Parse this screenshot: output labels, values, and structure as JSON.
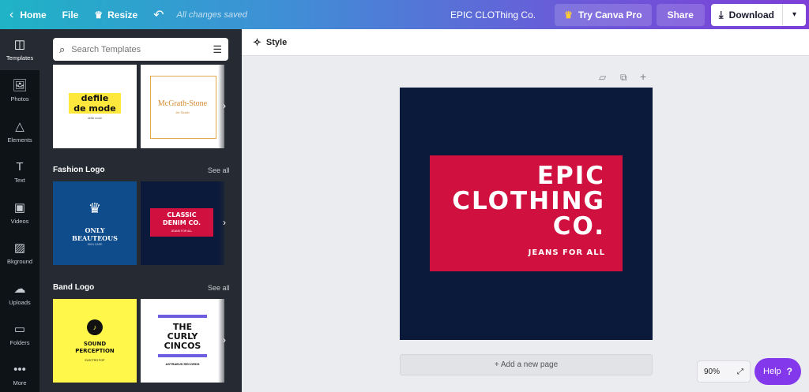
{
  "topbar": {
    "home_label": "Home",
    "file_label": "File",
    "resize_label": "Resize",
    "saved_status": "All changes saved",
    "doc_title": "EPIC CLOThing Co.",
    "try_pro_label": "Try Canva Pro",
    "share_label": "Share",
    "download_label": "Download",
    "icons": {
      "home": "chevron-left-icon",
      "resize": "crown-icon",
      "undo": "undo-icon",
      "download": "download-icon",
      "dropdown": "chevron-down-icon"
    }
  },
  "rail": {
    "items": [
      {
        "label": "Templates",
        "icon": "template-icon",
        "active": true
      },
      {
        "label": "Photos",
        "icon": "photo-icon"
      },
      {
        "label": "Elements",
        "icon": "shapes-icon"
      },
      {
        "label": "Text",
        "icon": "text-icon"
      },
      {
        "label": "Videos",
        "icon": "video-icon"
      },
      {
        "label": "Bkground",
        "icon": "background-icon"
      },
      {
        "label": "Uploads",
        "icon": "upload-icon"
      },
      {
        "label": "Folders",
        "icon": "folder-icon"
      },
      {
        "label": "More",
        "icon": "more-icon"
      }
    ]
  },
  "panel": {
    "search_placeholder": "Search Templates",
    "sections": [
      {
        "title": "Fashion Logo",
        "see_all": "See all"
      },
      {
        "title": "Band Logo",
        "see_all": "See all"
      }
    ],
    "templates": {
      "t1": {
        "name": "defile\nde mode",
        "sub": "defile mode"
      },
      "t2": {
        "name": "McGrath-Stone",
        "sub": "Art Studio"
      },
      "t3": {
        "name": "ONLY\nBEAUTEOUS",
        "sub": "SKIN CARE"
      },
      "t4": {
        "name": "CLASSIC\nDENIM CO.",
        "sub": "JEANS FOR ALL"
      },
      "t5": {
        "name": "SOUND\nPERCEPTION",
        "sub": "ELECTRO POP"
      },
      "t6": {
        "name": "THE\nCURLY\nCINCOS",
        "sub": "ASTRAEUS RECORDS"
      }
    }
  },
  "main": {
    "style_label": "Style",
    "canvas": {
      "title": "EPIC\nCLOTHING\nCO.",
      "tagline": "JEANS FOR ALL",
      "bg_color": "#0b1a3b",
      "box_color": "#d0103f"
    },
    "add_page_label": "+ Add a new page",
    "zoom_label": "90%",
    "help_label": "Help",
    "help_icon": "?"
  }
}
